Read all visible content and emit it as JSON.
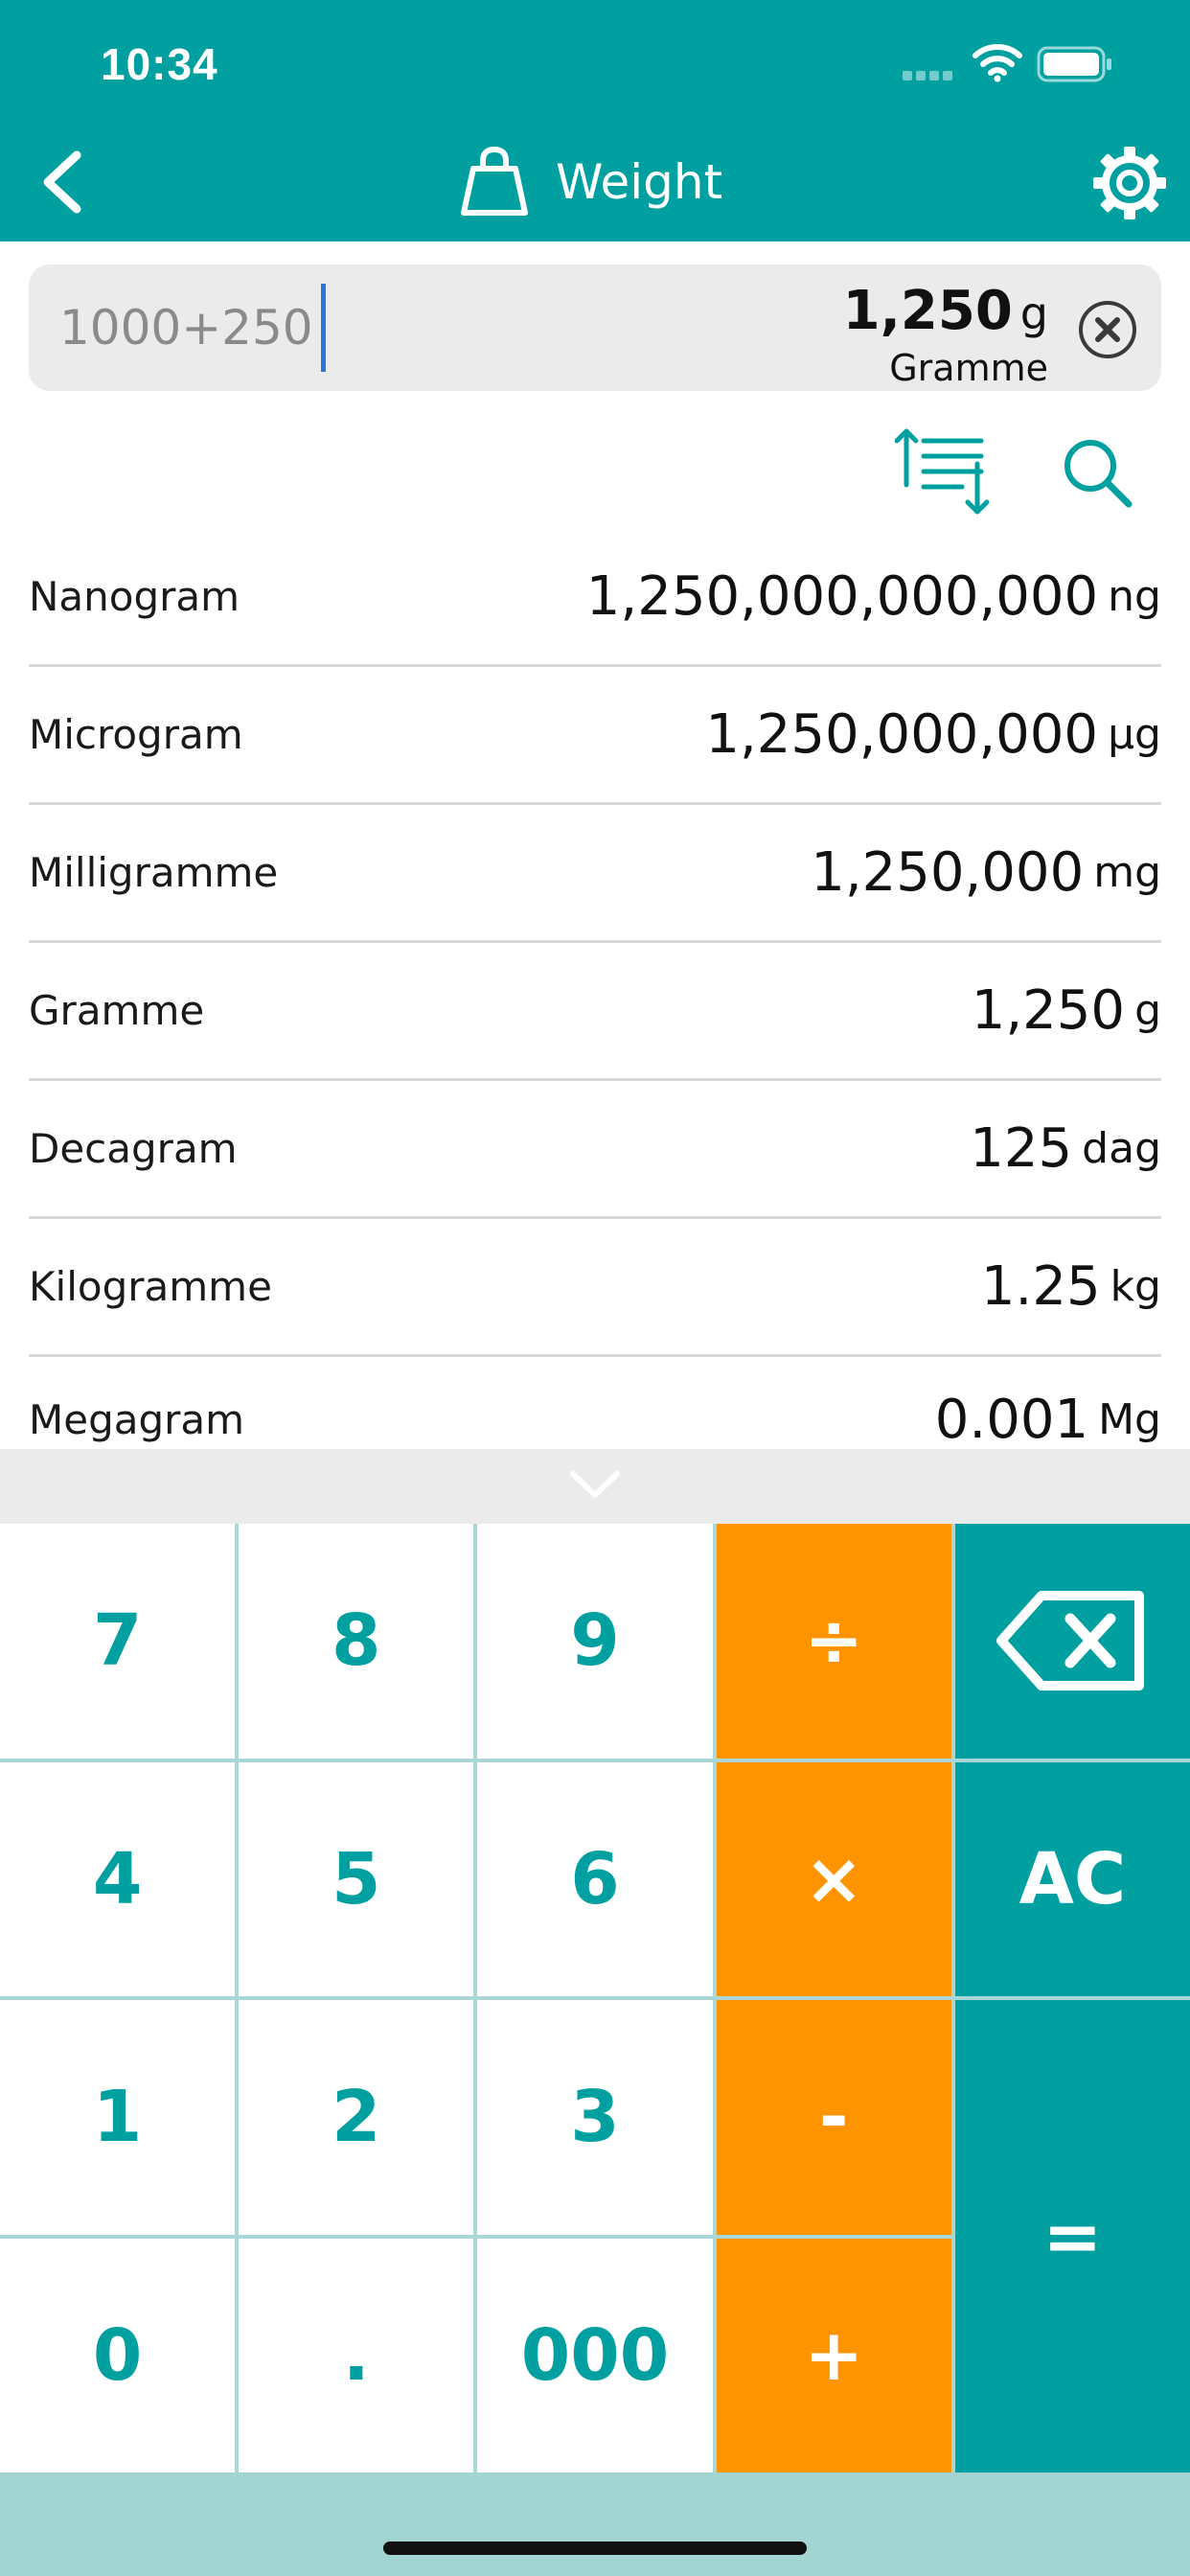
{
  "status_bar": {
    "time": "10:34"
  },
  "nav": {
    "title": "Weight"
  },
  "input": {
    "expression": "1000+250",
    "result_value": "1,250",
    "result_symbol": "g",
    "result_unit_name": "Gramme"
  },
  "units": [
    {
      "name": "Nanogram",
      "value": "1,250,000,000,000",
      "symbol": "ng"
    },
    {
      "name": "Microgram",
      "value": "1,250,000,000",
      "symbol": "µg"
    },
    {
      "name": "Milligramme",
      "value": "1,250,000",
      "symbol": "mg"
    },
    {
      "name": "Gramme",
      "value": "1,250",
      "symbol": "g"
    },
    {
      "name": "Decagram",
      "value": "125",
      "symbol": "dag"
    },
    {
      "name": "Kilogramme",
      "value": "1.25",
      "symbol": "kg"
    },
    {
      "name": "Megagram",
      "value": "0.001",
      "symbol": "Mg"
    }
  ],
  "keypad": {
    "k7": "7",
    "k8": "8",
    "k9": "9",
    "divide": "÷",
    "k4": "4",
    "k5": "5",
    "k6": "6",
    "multiply": "×",
    "clear_all": "AC",
    "k1": "1",
    "k2": "2",
    "k3": "3",
    "minus": "-",
    "equals": "=",
    "k0": "0",
    "dot": ".",
    "k000": "000",
    "plus": "+"
  },
  "colors": {
    "primary": "#00A0A0",
    "operator": "#FF9300",
    "input_background": "#EBEBEB",
    "caret": "#2B74D9",
    "bottom_bar": "#A2D5D2"
  },
  "icons": {
    "back": "chevron-left-icon",
    "title": "weight-icon",
    "settings": "gear-icon",
    "clear": "close-circle-icon",
    "sort": "sort-icon",
    "search": "search-icon",
    "collapse": "chevron-down-icon",
    "backspace": "backspace-icon"
  }
}
